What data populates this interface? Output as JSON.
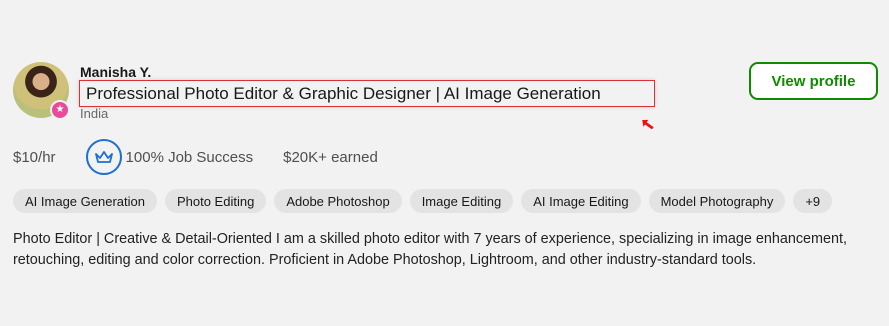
{
  "profile": {
    "name": "Manisha Y.",
    "title": "Professional Photo Editor & Graphic Designer | AI Image Generation",
    "location": "India",
    "avatar_badge_icon": "star-badge-icon"
  },
  "actions": {
    "view_profile_label": "View profile"
  },
  "stats": {
    "rate": "$10/hr",
    "job_success": "100% Job Success",
    "earned": "$20K+ earned"
  },
  "skills": [
    "AI Image Generation",
    "Photo Editing",
    "Adobe Photoshop",
    "Image Editing",
    "AI Image Editing",
    "Model Photography",
    "+9"
  ],
  "description": "Photo Editor | Creative & Detail-Oriented I am a skilled photo editor with 7 years of experience, specializing in image enhancement, retouching, editing and color correction. Proficient in Adobe Photoshop, Lightroom, and other industry-standard tools.",
  "colors": {
    "accent_green": "#108a00",
    "highlight_red": "#d9303a",
    "badge_pink": "#e94b9b",
    "success_blue": "#1d6fd1"
  }
}
